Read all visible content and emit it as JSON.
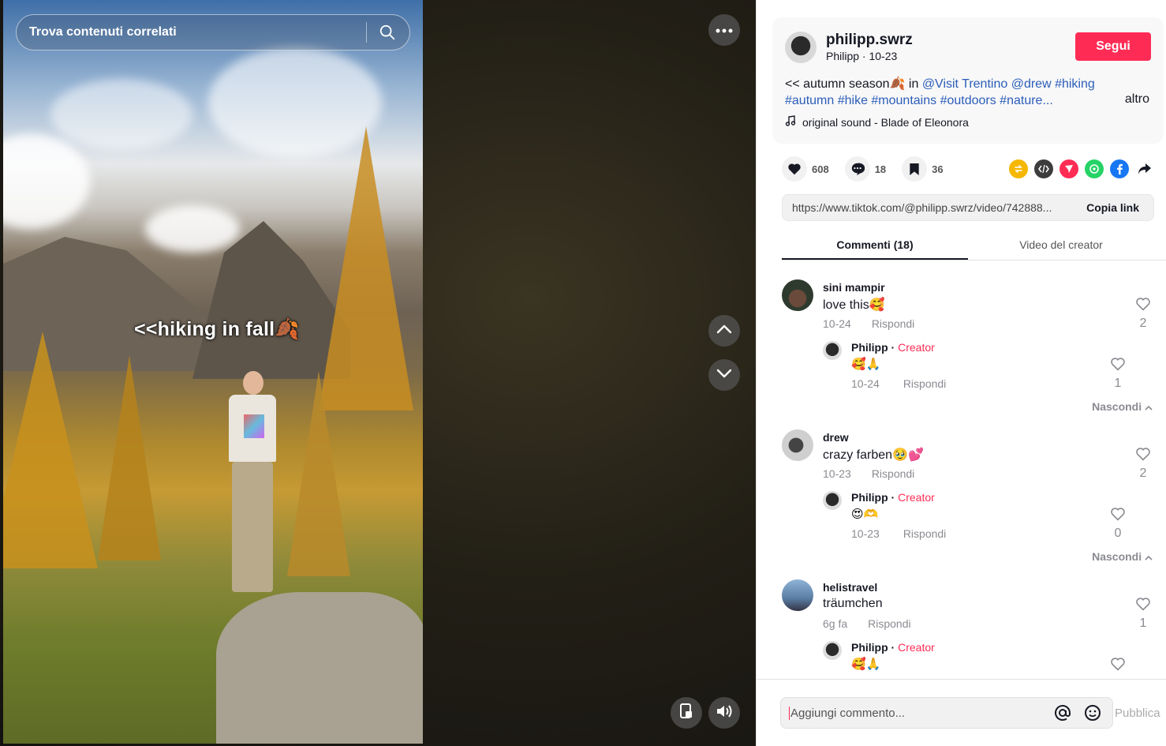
{
  "search": {
    "placeholder": "Trova contenuti correlati"
  },
  "video": {
    "overlay_text": "<<hiking in fall🍂"
  },
  "author": {
    "username": "philipp.swrz",
    "nickname_date": "Philipp · 10-23",
    "follow_label": "Segui"
  },
  "caption": {
    "text": "<< autumn season🍂 in ",
    "mention1": "@Visit Trentino",
    "mention2": "@drew",
    "tag1": "#hiking",
    "tags_line2": "#autumn #hike #mountains #outdoors #nature...",
    "more_label": "altro"
  },
  "music": {
    "label": "original sound - Blade of Eleonora"
  },
  "stats": {
    "likes": "608",
    "comments": "18",
    "saves": "36"
  },
  "share": {
    "colors": {
      "repost": "#f5b700",
      "embed": "#3d3d3d",
      "send": "#fe2c55",
      "whatsapp": "#25d366",
      "facebook": "#1877f2"
    }
  },
  "linkbar": {
    "url": "https://www.tiktok.com/@philipp.swrz/video/742888...",
    "copy_label": "Copia link"
  },
  "tabs": [
    {
      "label": "Commenti (18)"
    },
    {
      "label": "Video del creator"
    }
  ],
  "comments": [
    {
      "name": "sini mampir",
      "text": "love this🥰",
      "date": "10-24",
      "reply_label": "Rispondi",
      "likes": "2",
      "reply": {
        "name": "Philipp",
        "badge": "Creator",
        "text": "🥰🙏",
        "date": "10-24",
        "reply_label": "Rispondi",
        "likes": "1"
      },
      "hide_label": "Nascondi"
    },
    {
      "name": "drew",
      "text": "crazy farben🥹💕",
      "date": "10-23",
      "reply_label": "Rispondi",
      "likes": "2",
      "reply": {
        "name": "Philipp",
        "badge": "Creator",
        "text": "😍🫶",
        "date": "10-23",
        "reply_label": "Rispondi",
        "likes": "0"
      },
      "hide_label": "Nascondi"
    },
    {
      "name": "helistravel",
      "text": "träumchen",
      "date": "6g fa",
      "reply_label": "Rispondi",
      "likes": "1",
      "reply": {
        "name": "Philipp",
        "badge": "Creator",
        "text": "🥰🙏"
      }
    }
  ],
  "comment_input": {
    "placeholder": "Aggiungi commento...",
    "publish_label": "Pubblica"
  }
}
